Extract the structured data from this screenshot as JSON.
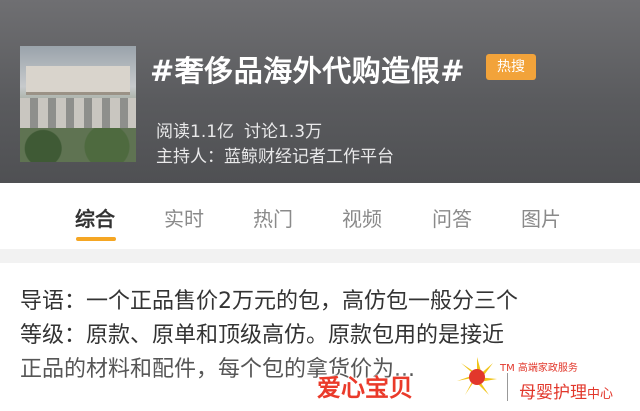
{
  "topic": {
    "title": "#奢侈品海外代购造假#",
    "badge": "热搜",
    "stats": {
      "reads": "阅读1.1亿",
      "discussions": "讨论1.3万"
    },
    "host": "主持人：蓝鲸财经记者工作平台"
  },
  "tabs": [
    {
      "label": "综合",
      "active": true
    },
    {
      "label": "实时",
      "active": false
    },
    {
      "label": "热门",
      "active": false
    },
    {
      "label": "视频",
      "active": false
    },
    {
      "label": "问答",
      "active": false
    },
    {
      "label": "图片",
      "active": false
    }
  ],
  "guide": {
    "line1": "导语：一个正品售价2万元的包，高仿包一般分三个",
    "line2": "等级：原款、原单和顶级高仿。原款包用的是接近",
    "line3": "正品的材料和配件，每个包的拿货价为..."
  },
  "watermark": {
    "main_text": "爱心宝贝",
    "small_text": "TM  高端家政服务",
    "sub_text": "母婴护理",
    "sub_suffix": "中心"
  },
  "colors": {
    "header_bg": "#5a5b5e",
    "badge_bg": "#f2a33a",
    "tab_accent": "#f5a623",
    "watermark_red": "#ea3a2a"
  }
}
